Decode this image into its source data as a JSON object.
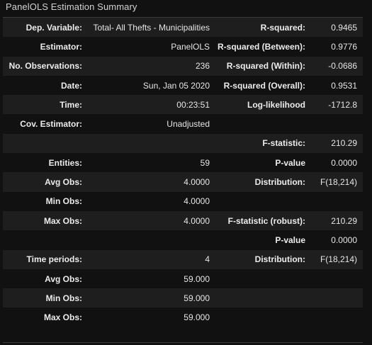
{
  "caption": "PanelOLS Estimation Summary",
  "rows": [
    [
      "Dep. Variable:",
      "Total- All Thefts - Municipalities",
      "R-squared:",
      "0.9465"
    ],
    [
      "Estimator:",
      "PanelOLS",
      "R-squared (Between):",
      "0.9776"
    ],
    [
      "No. Observations:",
      "236",
      "R-squared (Within):",
      "-0.0686"
    ],
    [
      "Date:",
      "Sun, Jan 05 2020",
      "R-squared (Overall):",
      "0.9531"
    ],
    [
      "Time:",
      "00:23:51",
      "Log-likelihood",
      "-1712.8"
    ],
    [
      "Cov. Estimator:",
      "Unadjusted",
      "",
      ""
    ],
    [
      "",
      "",
      "F-statistic:",
      "210.29"
    ],
    [
      "Entities:",
      "59",
      "P-value",
      "0.0000"
    ],
    [
      "Avg Obs:",
      "4.0000",
      "Distribution:",
      "F(18,214)"
    ],
    [
      "Min Obs:",
      "4.0000",
      "",
      ""
    ],
    [
      "Max Obs:",
      "4.0000",
      "F-statistic (robust):",
      "210.29"
    ],
    [
      "",
      "",
      "P-value",
      "0.0000"
    ],
    [
      "Time periods:",
      "4",
      "Distribution:",
      "F(18,214)"
    ],
    [
      "Avg Obs:",
      "59.000",
      "",
      ""
    ],
    [
      "Min Obs:",
      "59.000",
      "",
      ""
    ],
    [
      "Max Obs:",
      "59.000",
      "",
      ""
    ]
  ]
}
